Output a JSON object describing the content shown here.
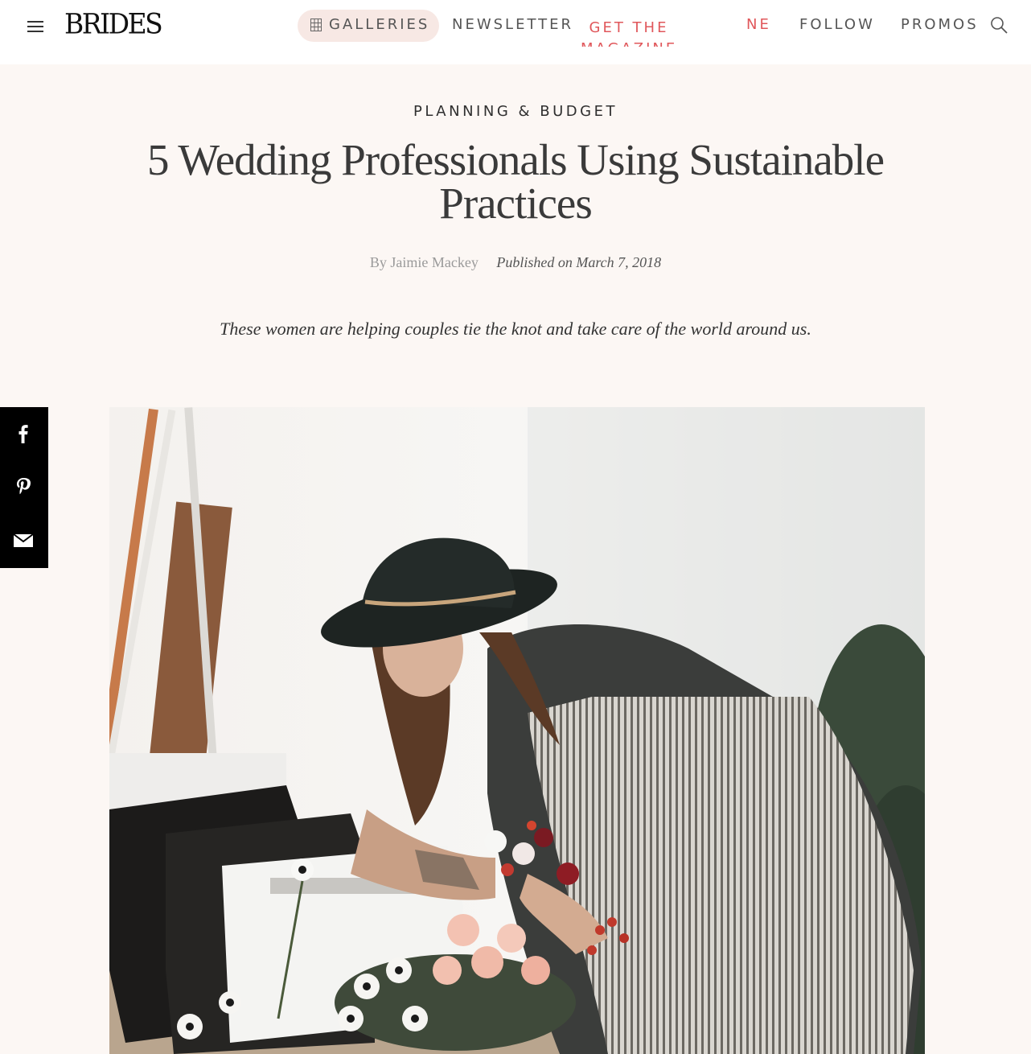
{
  "header": {
    "logo": "BRIDES",
    "nav": {
      "galleries": "GALLERIES",
      "newsletter": "NEWSLETTER",
      "magazine": "GET THE MAGAZINE",
      "ne": "NE",
      "follow": "FOLLOW",
      "promos": "PROMOS"
    },
    "accent_color": "#e0575b"
  },
  "article": {
    "kicker": "PLANNING & BUDGET",
    "title": "5 Wedding Professionals Using Sustainable Practices",
    "byline_prefix": "By",
    "author": "Jaimie Mackey",
    "published": "Published on March 7, 2018",
    "dek": "These women are helping couples tie the knot and take care of the world around us."
  },
  "share": {
    "icons": [
      "facebook-icon",
      "pinterest-icon",
      "email-icon"
    ]
  },
  "hero": {
    "icon": "hero-photo"
  }
}
